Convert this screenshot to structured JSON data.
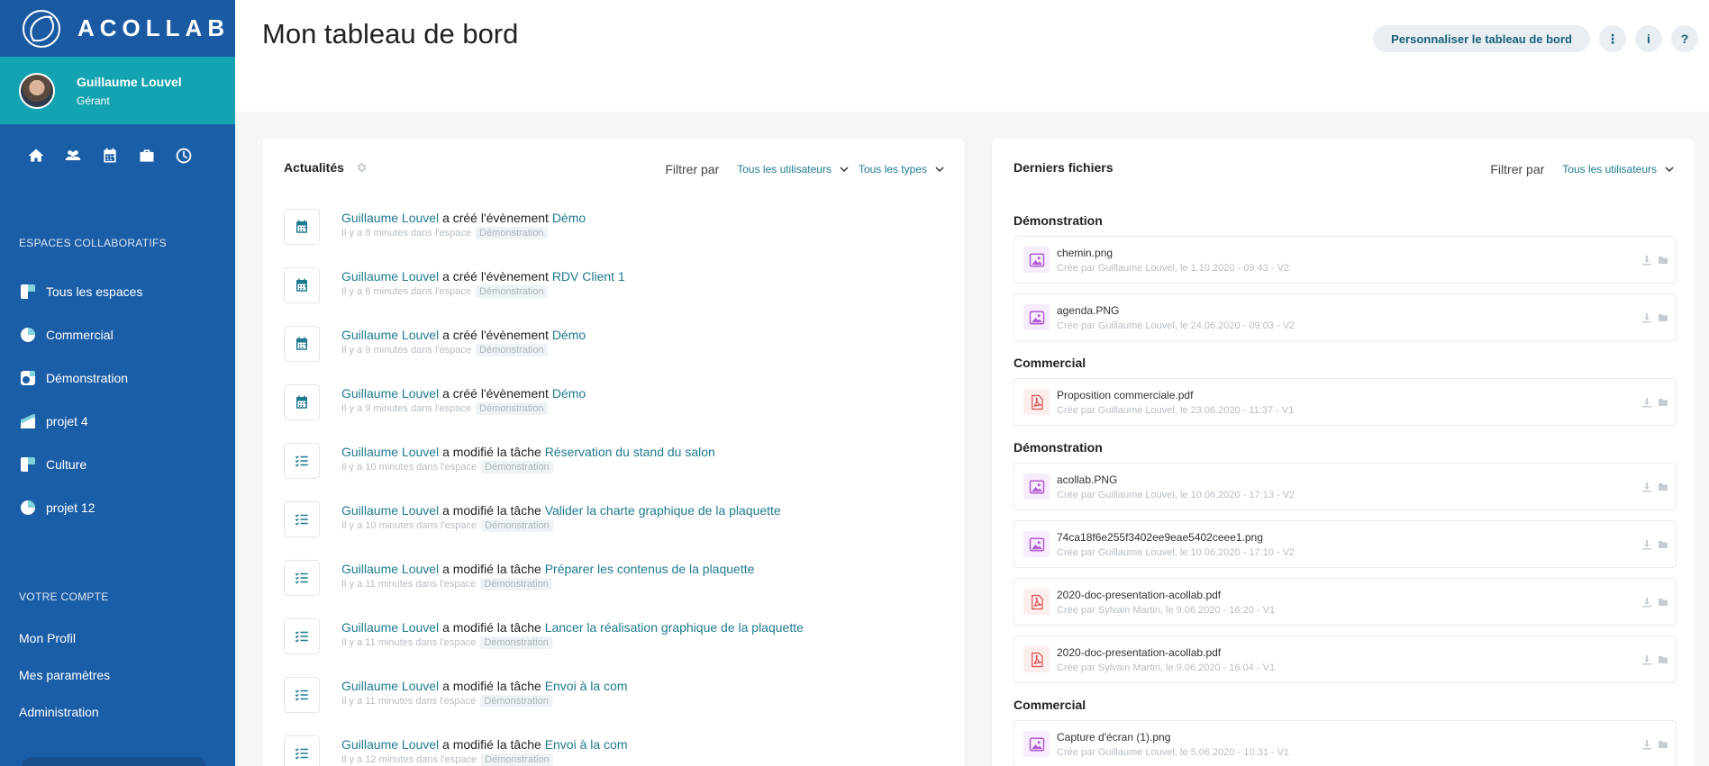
{
  "brand": {
    "name": "ACOLLAB"
  },
  "user": {
    "name": "Guillaume Louvel",
    "role": "Gérant"
  },
  "sidebar": {
    "spaces_title": "ESPACES COLLABORATIFS",
    "spaces": [
      {
        "label": "Tous les espaces"
      },
      {
        "label": "Commercial"
      },
      {
        "label": "Démonstration"
      },
      {
        "label": "projet 4"
      },
      {
        "label": "Culture"
      },
      {
        "label": "projet 12"
      }
    ],
    "account_title": "VOTRE COMPTE",
    "account": [
      {
        "label": "Mon Profil"
      },
      {
        "label": "Mes paramètres"
      },
      {
        "label": "Administration"
      }
    ]
  },
  "header": {
    "title": "Mon tableau de bord",
    "customize_label": "Personnaliser le tableau de bord",
    "more_label": "⋮",
    "info_label": "i",
    "help_label": "?"
  },
  "news": {
    "title": "Actualités",
    "filter_label": "Filtrer par",
    "filter_users": "Tous les utilisateurs",
    "filter_types": "Tous les types",
    "items": [
      {
        "icon": "calendar-icon",
        "user": "Guillaume Louvel",
        "verb": "a créé l'évènement",
        "target": "Démo",
        "time": "Il y a 8 minutes dans l'espace",
        "space": "Démonstration"
      },
      {
        "icon": "calendar-icon",
        "user": "Guillaume Louvel",
        "verb": "a créé l'évènement",
        "target": "RDV Client 1",
        "time": "Il y a 8 minutes dans l'espace",
        "space": "Démonstration"
      },
      {
        "icon": "calendar-icon",
        "user": "Guillaume Louvel",
        "verb": "a créé l'évènement",
        "target": "Démo",
        "time": "Il y a 9 minutes dans l'espace",
        "space": "Démonstration"
      },
      {
        "icon": "calendar-icon",
        "user": "Guillaume Louvel",
        "verb": "a créé l'évènement",
        "target": "Démo",
        "time": "Il y a 9 minutes dans l'espace",
        "space": "Démonstration"
      },
      {
        "icon": "task-list-icon",
        "user": "Guillaume Louvel",
        "verb": "a modifié la tâche",
        "target": "Réservation du stand du salon",
        "time": "Il y a 10 minutes dans l'espace",
        "space": "Démonstration"
      },
      {
        "icon": "task-list-icon",
        "user": "Guillaume Louvel",
        "verb": "a modifié la tâche",
        "target": "Valider la charte graphique de la plaquette",
        "time": "Il y a 10 minutes dans l'espace",
        "space": "Démonstration"
      },
      {
        "icon": "task-list-icon",
        "user": "Guillaume Louvel",
        "verb": "a modifié la tâche",
        "target": "Préparer les contenus de la plaquette",
        "time": "Il y a 11 minutes dans l'espace",
        "space": "Démonstration"
      },
      {
        "icon": "task-list-icon",
        "user": "Guillaume Louvel",
        "verb": "a modifié la tâche",
        "target": "Lancer la réalisation graphique de la plaquette",
        "time": "Il y a 11 minutes dans l'espace",
        "space": "Démonstration"
      },
      {
        "icon": "task-list-icon",
        "user": "Guillaume Louvel",
        "verb": "a modifié la tâche",
        "target": "Envoi à la com",
        "time": "Il y a 11 minutes dans l'espace",
        "space": "Démonstration"
      },
      {
        "icon": "task-list-icon",
        "user": "Guillaume Louvel",
        "verb": "a modifié la tâche",
        "target": "Envoi à la com",
        "time": "Il y a 12 minutes dans l'espace",
        "space": "Démonstration"
      }
    ]
  },
  "files": {
    "title": "Derniers fichiers",
    "filter_label": "Filtrer par",
    "filter_users": "Tous les utilisateurs",
    "groups": [
      {
        "title": "Démonstration",
        "items": [
          {
            "type": "image",
            "name": "chemin.png",
            "meta": "Crée par Guillaume Louvel, le 1.10.2020 - 09:43 - V2"
          },
          {
            "type": "image",
            "name": "agenda.PNG",
            "meta": "Crée par Guillaume Louvel, le 24.06.2020 - 09:03 - V2"
          }
        ]
      },
      {
        "title": "Commercial",
        "items": [
          {
            "type": "pdf",
            "name": "Proposition commerciale.pdf",
            "meta": "Crée par Guillaume Louvel, le 23.06.2020 - 11:37 - V1"
          }
        ]
      },
      {
        "title": "Démonstration",
        "items": [
          {
            "type": "image",
            "name": "acollab.PNG",
            "meta": "Crée par Guillaume Louvel, le 10.06.2020 - 17:13 - V2"
          },
          {
            "type": "image",
            "name": "74ca18f6e255f3402ee9eae5402ceee1.png",
            "meta": "Crée par Guillaume Louvel, le 10.06.2020 - 17:10 - V2"
          },
          {
            "type": "pdf",
            "name": "2020-doc-presentation-acollab.pdf",
            "meta": "Crée par Sylvain Martin, le 9.06.2020 - 16:20 - V1"
          },
          {
            "type": "pdf",
            "name": "2020-doc-presentation-acollab.pdf",
            "meta": "Crée par Sylvain Martin, le 9.06.2020 - 16:04 - V1"
          }
        ]
      },
      {
        "title": "Commercial",
        "items": [
          {
            "type": "image",
            "name": "Capture d'écran (1).png",
            "meta": "Crée par Guillaume Louvel, le 5.06.2020 - 10:31 - V1"
          }
        ]
      }
    ]
  },
  "colors": {
    "sidebar": "#1b5ea8",
    "user_block": "#14a3b0",
    "link": "#1f7a8f",
    "image_icon": "#b25bd6",
    "pdf_icon": "#e04b4b"
  }
}
